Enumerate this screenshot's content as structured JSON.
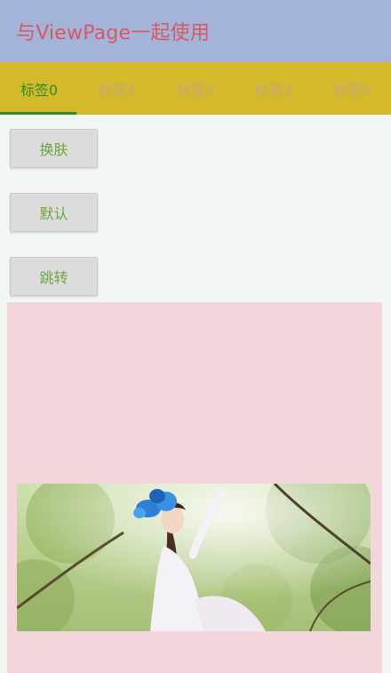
{
  "appbar": {
    "title": "与ViewPage一起使用"
  },
  "tabs": [
    {
      "label": "标签0",
      "active": true
    },
    {
      "label": "标签1",
      "active": false
    },
    {
      "label": "标签2",
      "active": false
    },
    {
      "label": "标签3",
      "active": false
    },
    {
      "label": "标签4",
      "active": false
    }
  ],
  "buttons": {
    "skin_label": "换肤",
    "default_label": "默认",
    "jump_label": "跳转"
  },
  "colors": {
    "appbar_bg": "#a3b3da",
    "title_text": "#d8595f",
    "tabbar_bg": "#d4ba2b",
    "tab_active": "#2e8b2c",
    "tab_inactive": "#c7a67a",
    "button_text": "#6aa640",
    "panel_bg": "#f3d6dc"
  }
}
